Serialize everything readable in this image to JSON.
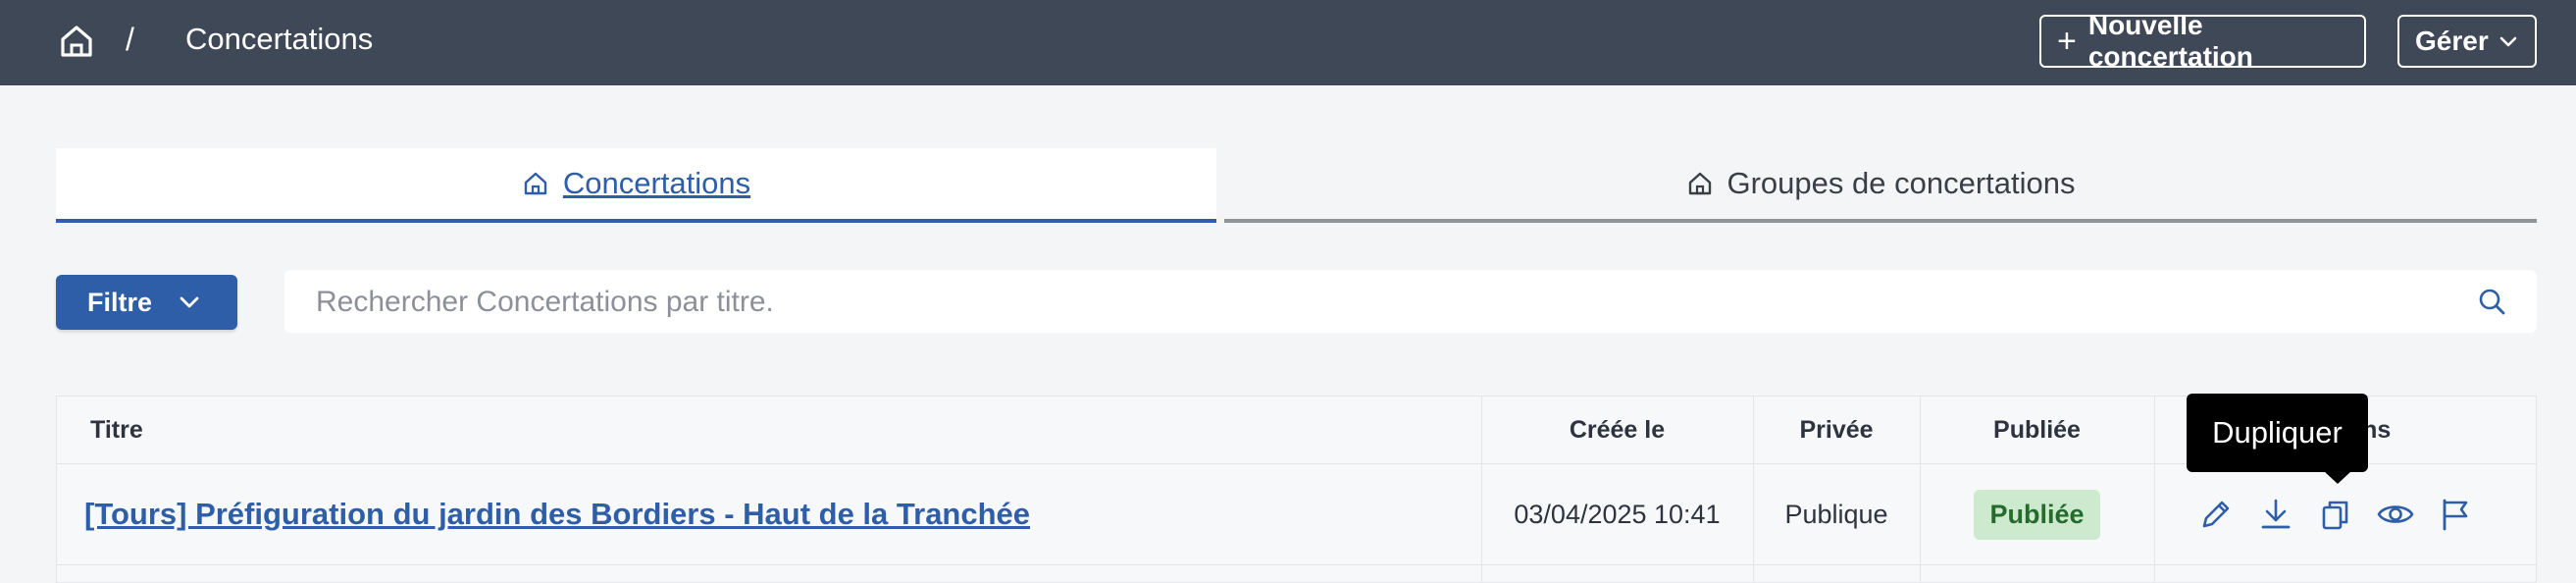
{
  "header": {
    "breadcrumb_separator": "/",
    "breadcrumb_current": "Concertations",
    "new_button_label": "Nouvelle concertation",
    "manage_button_label": "Gérer"
  },
  "tabs": [
    {
      "label": "Concertations",
      "active": true
    },
    {
      "label": "Groupes de concertations",
      "active": false
    }
  ],
  "filter": {
    "label": "Filtre"
  },
  "search": {
    "placeholder": "Rechercher Concertations par titre.",
    "value": ""
  },
  "table": {
    "columns": [
      "Titre",
      "Créée le",
      "Privée",
      "Publiée",
      "Actions"
    ],
    "visible_column_fragment": "s",
    "rows": [
      {
        "title": "[Tours] Préfiguration du jardin des Bordiers - Haut de la Tranchée",
        "created": "03/04/2025 10:41",
        "private": "Publique",
        "published": "Publiée",
        "actions": [
          "pencil-icon",
          "download-icon",
          "duplicate-icon",
          "eye-icon",
          "flag-icon"
        ]
      }
    ]
  },
  "tooltip": {
    "text": "Dupliquer"
  },
  "colors": {
    "header_bg": "#3f4856",
    "accent": "#2e5ea8",
    "page_bg": "#f4f5f7",
    "badge_bg": "#cdeacf",
    "badge_text": "#256b2d"
  }
}
